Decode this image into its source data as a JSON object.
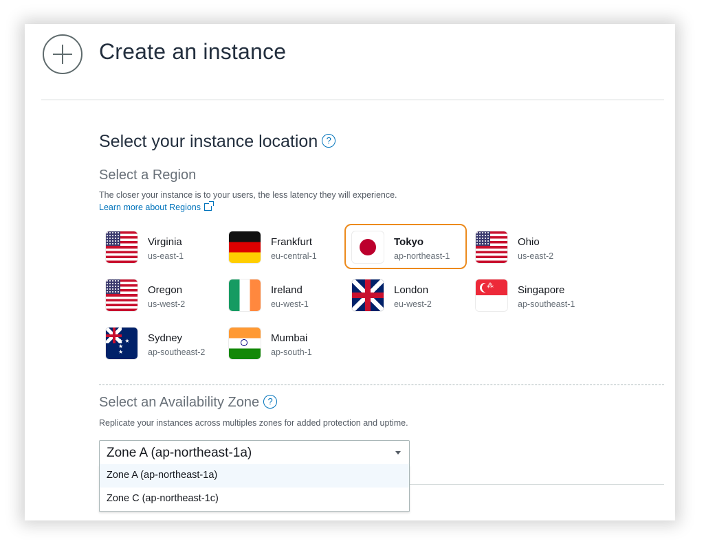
{
  "header": {
    "title": "Create an instance",
    "icon": "plus-circle-icon"
  },
  "location": {
    "title": "Select your instance location",
    "help": "?"
  },
  "region": {
    "title": "Select a Region",
    "description": "The closer your instance is to your users, the less latency they will experience.",
    "learn_more": "Learn more about Regions",
    "selected": "Tokyo",
    "items": [
      {
        "name": "Virginia",
        "code": "us-east-1",
        "flag": "us-flag-icon"
      },
      {
        "name": "Frankfurt",
        "code": "eu-central-1",
        "flag": "germany-flag-icon"
      },
      {
        "name": "Tokyo",
        "code": "ap-northeast-1",
        "flag": "japan-flag-icon"
      },
      {
        "name": "Ohio",
        "code": "us-east-2",
        "flag": "us-flag-icon"
      },
      {
        "name": "Oregon",
        "code": "us-west-2",
        "flag": "us-flag-icon"
      },
      {
        "name": "Ireland",
        "code": "eu-west-1",
        "flag": "ireland-flag-icon"
      },
      {
        "name": "London",
        "code": "eu-west-2",
        "flag": "uk-flag-icon"
      },
      {
        "name": "Singapore",
        "code": "ap-southeast-1",
        "flag": "singapore-flag-icon"
      },
      {
        "name": "Sydney",
        "code": "ap-southeast-2",
        "flag": "australia-flag-icon"
      },
      {
        "name": "Mumbai",
        "code": "ap-south-1",
        "flag": "india-flag-icon"
      }
    ]
  },
  "zone": {
    "title": "Select an Availability Zone",
    "help": "?",
    "description": "Replicate your instances across multiples zones for added protection and uptime.",
    "selected": "Zone A (ap-northeast-1a)",
    "options": [
      "Zone A (ap-northeast-1a)",
      "Zone C (ap-northeast-1c)"
    ]
  },
  "colors": {
    "selected_border": "#ec8a1c",
    "link": "#0073bb",
    "heading": "#232f3e"
  }
}
